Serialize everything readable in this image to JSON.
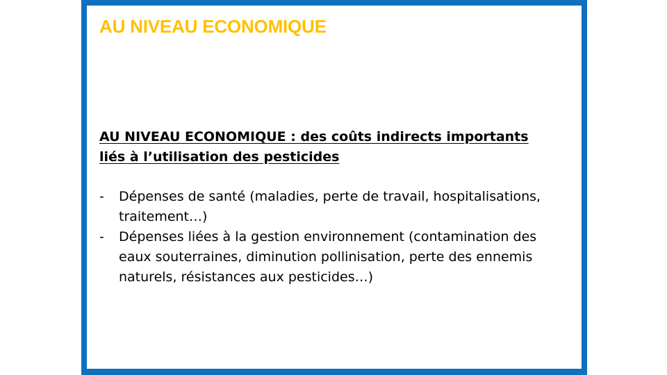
{
  "slide": {
    "title": "AU NIVEAU ECONOMIQUE",
    "colors": {
      "title": "#FFC000",
      "frame": "#1070C0",
      "text": "#000000"
    }
  },
  "content": {
    "heading": "AU NIVEAU ECONOMIQUE : des coûts indirects importants liés à l’utilisation des pesticides",
    "bullet_marker": "-",
    "bullets": [
      "Dépenses de santé (maladies, perte de travail, hospitalisations, traitement…)",
      "Dépenses liées à la gestion environnement (contamination des eaux souterraines, diminution pollinisation, perte des ennemis naturels, résistances aux pesticides…)"
    ]
  }
}
